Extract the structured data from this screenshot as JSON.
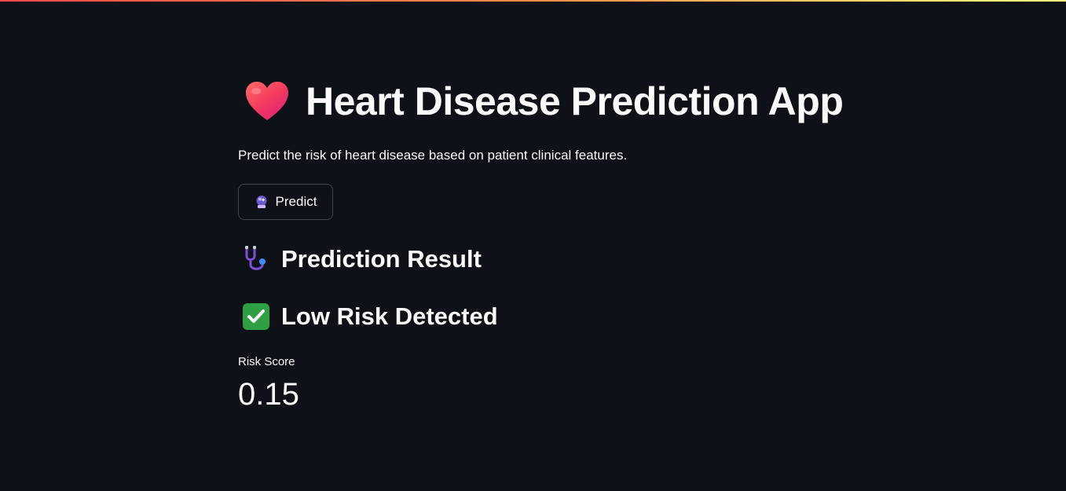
{
  "header": {
    "title": "Heart Disease Prediction App",
    "title_icon": "heart-icon",
    "subtitle": "Predict the risk of heart disease based on patient clinical features."
  },
  "predict_button": {
    "label": "Predict",
    "icon": "crystal-ball-icon"
  },
  "result": {
    "heading": "Prediction Result",
    "heading_icon": "stethoscope-icon",
    "status": "Low Risk Detected",
    "status_icon": "check-mark-icon"
  },
  "metric": {
    "label": "Risk Score",
    "value": "0.15"
  },
  "colors": {
    "background": "#0e1117",
    "text": "#fafafa",
    "success": "#2ea043",
    "accent_gradient_start": "#ff4b4b",
    "accent_gradient_end": "#fffd80"
  }
}
